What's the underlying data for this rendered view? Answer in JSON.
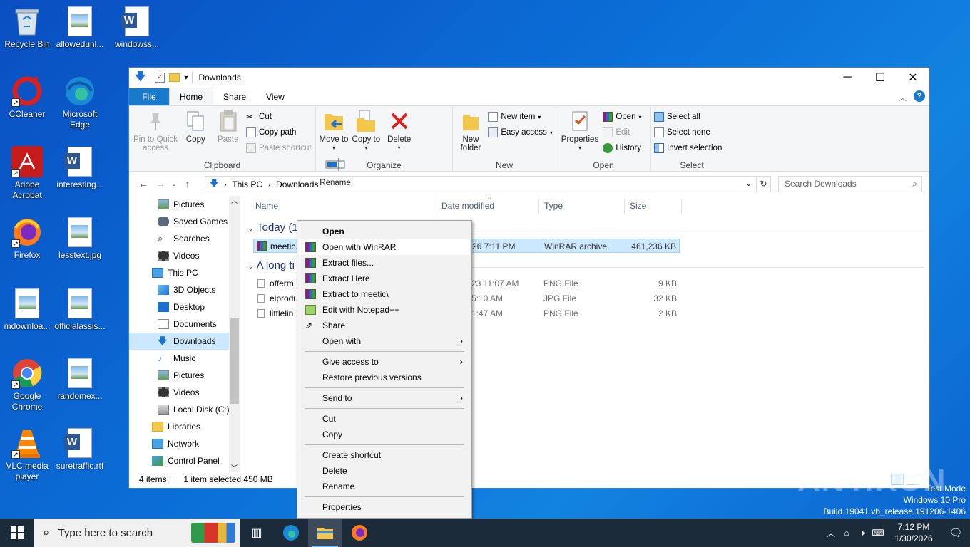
{
  "desktop": {
    "icons": [
      {
        "label": "Recycle Bin"
      },
      {
        "label": "allowedunl..."
      },
      {
        "label": "windowss..."
      },
      {
        "label": "CCleaner"
      },
      {
        "label": "Microsoft Edge"
      },
      {
        "label": "Adobe Acrobat"
      },
      {
        "label": "interesting..."
      },
      {
        "label": "Firefox"
      },
      {
        "label": "lesstext.jpg"
      },
      {
        "label": "mdownloa..."
      },
      {
        "label": "officialassis..."
      },
      {
        "label": "Google Chrome"
      },
      {
        "label": "randomex..."
      },
      {
        "label": "VLC media player"
      },
      {
        "label": "suretraffic.rtf"
      }
    ]
  },
  "window": {
    "title": "Downloads",
    "tabs": [
      "File",
      "Home",
      "Share",
      "View"
    ],
    "ribbon": {
      "clipboard": {
        "name": "Clipboard",
        "pin": "Pin to Quick access",
        "copy": "Copy",
        "paste": "Paste",
        "cut": "Cut",
        "copy_path": "Copy path",
        "paste_shortcut": "Paste shortcut"
      },
      "organize": {
        "name": "Organize",
        "move_to": "Move to",
        "copy_to": "Copy to",
        "delete": "Delete",
        "rename": "Rename"
      },
      "new": {
        "name": "New",
        "new_folder": "New folder",
        "new_item": "New item",
        "easy_access": "Easy access"
      },
      "open": {
        "name": "Open",
        "properties": "Properties",
        "open": "Open",
        "edit": "Edit",
        "history": "History"
      },
      "select": {
        "name": "Select",
        "select_all": "Select all",
        "select_none": "Select none",
        "invert": "Invert selection"
      }
    },
    "address": {
      "crumbs": [
        "This PC",
        "Downloads"
      ],
      "search_placeholder": "Search Downloads"
    },
    "nav": [
      {
        "label": "Pictures"
      },
      {
        "label": "Saved Games"
      },
      {
        "label": "Searches"
      },
      {
        "label": "Videos"
      },
      {
        "label": "This PC"
      },
      {
        "label": "3D Objects"
      },
      {
        "label": "Desktop"
      },
      {
        "label": "Documents"
      },
      {
        "label": "Downloads"
      },
      {
        "label": "Music"
      },
      {
        "label": "Pictures"
      },
      {
        "label": "Videos"
      },
      {
        "label": "Local Disk (C:)"
      },
      {
        "label": "Libraries"
      },
      {
        "label": "Network"
      },
      {
        "label": "Control Panel"
      }
    ],
    "columns": [
      "Name",
      "Date modified",
      "Type",
      "Size"
    ],
    "groups": [
      {
        "label": "Today (1"
      },
      {
        "label": "A long ti"
      }
    ],
    "files": [
      {
        "name": "meetic.",
        "date": "26 7:11 PM",
        "type": "WinRAR archive",
        "size": "461,236 KB"
      },
      {
        "name": "offerm",
        "date": "23 11:07 AM",
        "type": "PNG File",
        "size": "9 KB"
      },
      {
        "name": "elprodu",
        "date": "5:10 AM",
        "type": "JPG File",
        "size": "32 KB"
      },
      {
        "name": "littlelin",
        "date": "1:47 AM",
        "type": "PNG File",
        "size": "2 KB"
      }
    ],
    "status": {
      "count": "4 items",
      "selected": "1 item selected  450 MB"
    }
  },
  "context_menu": {
    "items": [
      "Open",
      "Open with WinRAR",
      "Extract files...",
      "Extract Here",
      "Extract to meetic\\",
      "Edit with Notepad++",
      "Share",
      "Open with",
      "Give access to",
      "Restore previous versions",
      "Send to",
      "Cut",
      "Copy",
      "Create shortcut",
      "Delete",
      "Rename",
      "Properties"
    ]
  },
  "taskbar": {
    "search_placeholder": "Type here to search",
    "time": "7:12 PM",
    "date": "1/30/2026"
  },
  "watermark": {
    "line1": "Test Mode",
    "line2": "Windows 10 Pro",
    "line3": "Build 19041.vb_release.191206-1406",
    "brand": "ANY.RUN"
  },
  "colors": {
    "accent": "#1979ca",
    "selection": "#cce8ff",
    "taskbar": "#1b2b3a"
  }
}
